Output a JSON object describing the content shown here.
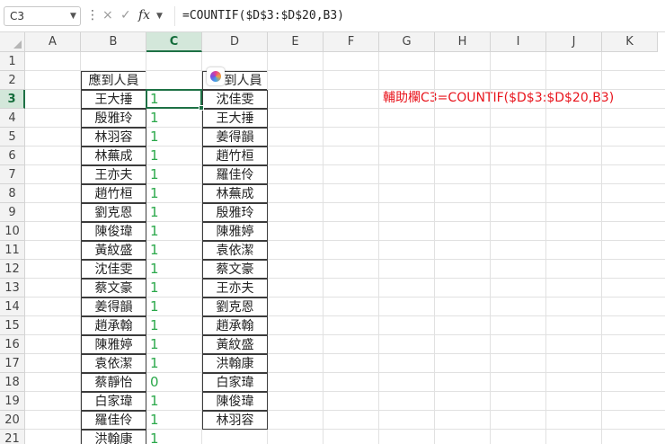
{
  "formula_bar": {
    "name_box": "C3",
    "menu_dots": "⋮",
    "cancel_icon": "×",
    "enter_icon": "✓",
    "fx_label": "fx",
    "formula": "=COUNTIF($D$3:$D$20,B3)"
  },
  "columns": [
    "A",
    "B",
    "C",
    "D",
    "E",
    "F",
    "G",
    "H",
    "I",
    "J",
    "K"
  ],
  "rows": [
    "1",
    "2",
    "3",
    "4",
    "5",
    "6",
    "7",
    "8",
    "9",
    "10",
    "11",
    "12",
    "13",
    "14",
    "15",
    "16",
    "17",
    "18",
    "19",
    "20",
    "21"
  ],
  "sheet": {
    "header_b": "應到人員",
    "header_d": "到人員",
    "col_b": [
      "王大捶",
      "殷雅玲",
      "林羽容",
      "林蕪成",
      "王亦夫",
      "趙竹桓",
      "劉克恩",
      "陳俊瑋",
      "黃紋盛",
      "沈佳雯",
      "蔡文豪",
      "姜得韻",
      "趙承翰",
      "陳雅婷",
      "袁依潔",
      "蔡靜怡",
      "白家瑋",
      "羅佳伶",
      "洪翰康"
    ],
    "col_c": [
      "1",
      "1",
      "1",
      "1",
      "1",
      "1",
      "1",
      "1",
      "1",
      "1",
      "1",
      "1",
      "1",
      "1",
      "1",
      "0",
      "1",
      "1",
      "1"
    ],
    "col_d": [
      "沈佳雯",
      "王大捶",
      "姜得韻",
      "趙竹桓",
      "羅佳伶",
      "林蕪成",
      "殷雅玲",
      "陳雅婷",
      "袁依潔",
      "蔡文豪",
      "王亦夫",
      "劉克恩",
      "趙承翰",
      "黃紋盛",
      "洪翰康",
      "白家瑋",
      "陳俊瑋",
      "林羽容"
    ],
    "note": "輔助欄C3=COUNTIF($D$3:$D$20,B3)"
  },
  "colors": {
    "count_text": "#2aa84a",
    "note_text": "#e8141c",
    "selection": "#1e7145"
  }
}
